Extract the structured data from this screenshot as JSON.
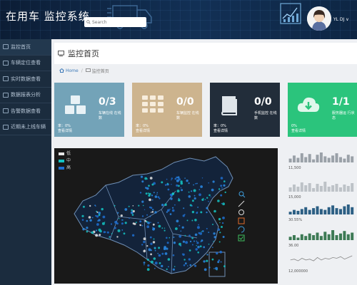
{
  "header": {
    "title": "在用车 监控系统",
    "search_placeholder": "Search",
    "username": "YL DJ ∨"
  },
  "sidebar": {
    "items": [
      {
        "label": "监控首页",
        "active": true
      },
      {
        "label": "车辆定位查看",
        "active": false
      },
      {
        "label": "实时数据查看",
        "active": false
      },
      {
        "label": "数据报表分析",
        "active": false
      },
      {
        "label": "告警数据查看",
        "active": false
      },
      {
        "label": "近期未上线车辆",
        "active": false
      }
    ]
  },
  "page": {
    "title": "监控首页",
    "breadcrumb_home": "Home",
    "breadcrumb_current": "监控首页"
  },
  "cards": [
    {
      "count": "0/3",
      "label": "车辆在线 在线数",
      "rate": "率：0%\n查看详情",
      "color": "#73a3b8",
      "icon": "cubes-icon"
    },
    {
      "count": "0/0",
      "label": "车辆监控 在线数",
      "rate": "率：0%\n查看详情",
      "color": "#cdb48e",
      "icon": "grid-icon"
    },
    {
      "count": "0/0",
      "label": "手机监控 在线数",
      "rate": "率：0%\n查看详情",
      "color": "#222d3a",
      "icon": "book-icon"
    },
    {
      "count": "1/1",
      "label": "服务器运 行状态",
      "rate": "0%\n查看详情",
      "color": "#2bc47c",
      "icon": "cloud-download-icon"
    }
  ],
  "map": {
    "legend": [
      {
        "label": "低",
        "color": "#e6e6e6"
      },
      {
        "label": "中",
        "color": "#14c4c4"
      },
      {
        "label": "高",
        "color": "#1f6fd1"
      }
    ]
  },
  "sparklines": [
    {
      "value": "11,500",
      "type": "bar",
      "color": "#9aa1a8",
      "bars": [
        5,
        9,
        6,
        12,
        7,
        11,
        4,
        10,
        13,
        8,
        6,
        9,
        12,
        7,
        5,
        10,
        8
      ]
    },
    {
      "value": "15,000",
      "type": "bar",
      "color": "#bdc2c7",
      "bars": [
        6,
        10,
        7,
        13,
        9,
        12,
        5,
        11,
        8,
        14,
        7,
        9,
        11,
        6,
        10,
        8,
        12
      ]
    },
    {
      "value": "30.55%",
      "type": "bar",
      "color": "#2c5f84",
      "bars": [
        3,
        5,
        4,
        6,
        8,
        5,
        7,
        9,
        6,
        5,
        8,
        10,
        7,
        6,
        9,
        11,
        8
      ]
    },
    {
      "value": "36.00",
      "type": "bar",
      "color": "#3d7a55",
      "bars": [
        4,
        6,
        3,
        7,
        5,
        8,
        6,
        9,
        5,
        10,
        7,
        12,
        6,
        8,
        11,
        7,
        9
      ]
    },
    {
      "value": "12,000000",
      "type": "line",
      "color": "#888888",
      "bars": [
        6,
        7,
        5,
        8,
        6,
        7,
        5,
        9,
        6,
        8,
        7,
        9,
        8,
        10,
        7,
        9,
        11
      ]
    }
  ],
  "icons": {
    "search": "search-icon",
    "avatar": "avatar-icon",
    "home": "home-icon",
    "page": "monitor-icon"
  }
}
